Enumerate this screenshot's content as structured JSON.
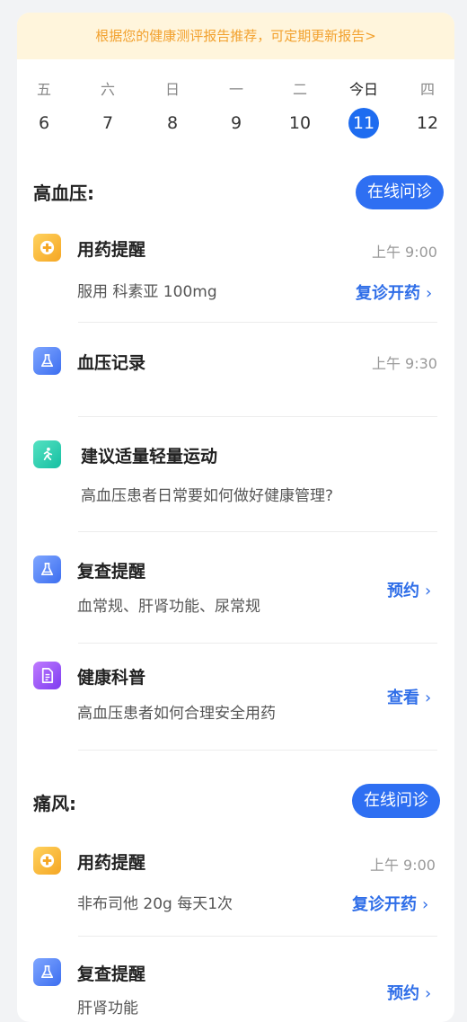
{
  "banner": {
    "text": "根据您的健康测评报告推荐，可定期更新报告>"
  },
  "week": [
    {
      "label": "五",
      "date": "6"
    },
    {
      "label": "六",
      "date": "7"
    },
    {
      "label": "日",
      "date": "8"
    },
    {
      "label": "一",
      "date": "9"
    },
    {
      "label": "二",
      "date": "10"
    },
    {
      "label": "今日",
      "date": "11"
    },
    {
      "label": "四",
      "date": "12"
    }
  ],
  "colors": {
    "accent": "#2e6ff2",
    "banner_text": "#f2a12e",
    "banner_bg": "#fff5dc"
  },
  "sections": [
    {
      "title": "高血压:",
      "consult_label": "在线问诊",
      "items": [
        {
          "icon": "pill-plus-icon",
          "title": "用药提醒",
          "time": "上午 9:00",
          "desc": "服用 科素亚 100mg",
          "link": "复诊开药"
        },
        {
          "icon": "flask-icon",
          "title": "血压记录",
          "time": "上午 9:30"
        },
        {
          "icon": "running-icon",
          "title": "建议适量轻量运动",
          "desc": "高血压患者日常要如何做好健康管理?"
        },
        {
          "icon": "flask-icon",
          "title": "复查提醒",
          "desc": "血常规、肝肾功能、尿常规",
          "link": "预约"
        },
        {
          "icon": "document-icon",
          "title": "健康科普",
          "desc": "高血压患者如何合理安全用药",
          "link": "查看"
        }
      ]
    },
    {
      "title": "痛风:",
      "consult_label": "在线问诊",
      "items": [
        {
          "icon": "pill-plus-icon",
          "title": "用药提醒",
          "time": "上午 9:00",
          "desc": "非布司他 20g 每天1次",
          "link": "复诊开药"
        },
        {
          "icon": "flask-icon",
          "title": "复查提醒",
          "desc": "肝肾功能",
          "link": "预约"
        }
      ]
    }
  ]
}
